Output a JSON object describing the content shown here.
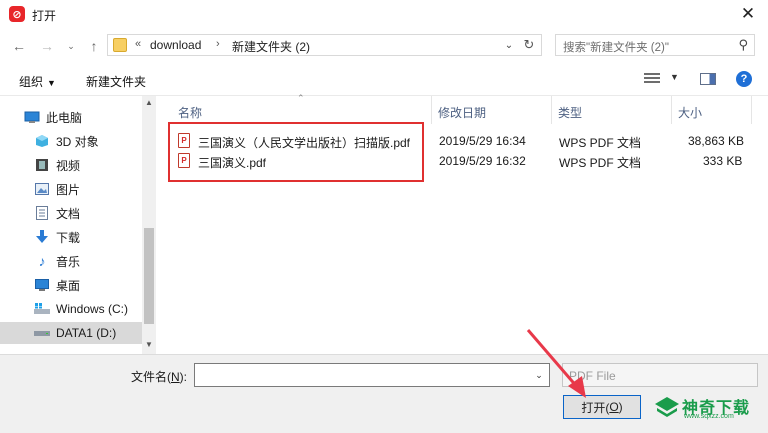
{
  "window": {
    "title": "打开",
    "app_icon_text": "⊘"
  },
  "address": {
    "prefix": "«",
    "segments": [
      "download",
      "新建文件夹 (2)"
    ],
    "separator": "›"
  },
  "search": {
    "placeholder": "搜索\"新建文件夹 (2)\""
  },
  "toolbar": {
    "organize_label": "组织",
    "new_folder_label": "新建文件夹"
  },
  "sidebar": {
    "items": [
      {
        "label": "此电脑",
        "icon": "computer-icon"
      },
      {
        "label": "3D 对象",
        "icon": "cube-icon"
      },
      {
        "label": "视频",
        "icon": "film-icon"
      },
      {
        "label": "图片",
        "icon": "picture-icon"
      },
      {
        "label": "文档",
        "icon": "document-icon"
      },
      {
        "label": "下载",
        "icon": "download-arrow-icon"
      },
      {
        "label": "音乐",
        "icon": "music-note-icon"
      },
      {
        "label": "桌面",
        "icon": "desktop-icon"
      },
      {
        "label": "Windows (C:)",
        "icon": "drive-icon"
      },
      {
        "label": "DATA1 (D:)",
        "icon": "drive-icon"
      }
    ]
  },
  "columns": {
    "name": "名称",
    "date": "修改日期",
    "type": "类型",
    "size": "大小"
  },
  "files": [
    {
      "name": "三国演义（人民文学出版社）扫描版.pdf",
      "date": "2019/5/29 16:34",
      "type": "WPS PDF 文档",
      "size": "38,863 KB"
    },
    {
      "name": "三国演义.pdf",
      "date": "2019/5/29 16:32",
      "type": "WPS PDF 文档",
      "size": "333 KB"
    }
  ],
  "bottom": {
    "filename_label": "文件名(",
    "filename_key": "N",
    "filename_label_end": "):",
    "filename_value": "",
    "filetype_value": "PDF File",
    "open_label": "打开(",
    "open_key": "O",
    "open_label_end": ")"
  },
  "watermark": {
    "text": "神奇下载",
    "url": "www.sqxzz.com"
  },
  "colors": {
    "accent": "#0a64c8",
    "highlight_border": "#e03030",
    "watermark": "#1a9c4b",
    "help": "#1f6fd6"
  }
}
